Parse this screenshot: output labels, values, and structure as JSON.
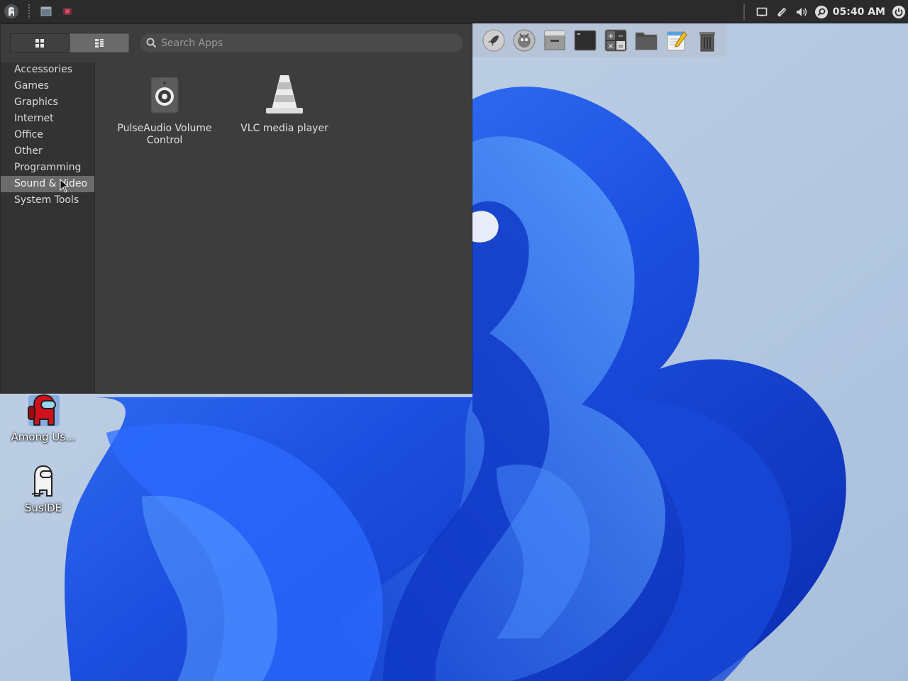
{
  "top_panel": {
    "clock": "05:40 AM",
    "tray_icons": [
      "screen-icon",
      "paperclip-icon",
      "volume-icon",
      "search-icon",
      "power-icon"
    ]
  },
  "menu": {
    "view_modes": [
      "grid-view-icon",
      "list-view-icon"
    ],
    "active_view": "list",
    "search_placeholder": "Search Apps",
    "categories": [
      "Accessories",
      "Games",
      "Graphics",
      "Internet",
      "Office",
      "Other",
      "Programming",
      "Sound & Video",
      "System Tools"
    ],
    "selected_category": "Sound & Video",
    "apps": [
      {
        "label": "PulseAudio Volume Control",
        "icon": "speaker-icon"
      },
      {
        "label": "VLC media player",
        "icon": "vlc-cone-icon"
      }
    ]
  },
  "dock": {
    "items": [
      "rocket-launcher-icon",
      "gimp-icon",
      "window-icon",
      "terminal-icon",
      "calculator-icon",
      "file-manager-icon",
      "text-editor-icon",
      "trash-icon"
    ]
  },
  "desktop": {
    "icons": [
      {
        "label": "Among Us...",
        "icon": "among-us-icon"
      },
      {
        "label": "SusIDE",
        "icon": "suside-icon"
      }
    ]
  },
  "colors": {
    "panel": "#2b2b2b",
    "menu_bg": "#3d3d3d",
    "category_bg": "#333333",
    "selected": "#6b6b6b",
    "wallpaper_blue": "#1e5bea"
  }
}
